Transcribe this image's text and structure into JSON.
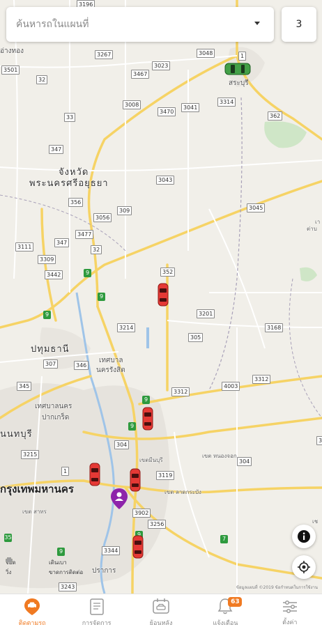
{
  "search": {
    "placeholder": "ค้นหารถในแผนที่"
  },
  "vehicle_count": "3",
  "map": {
    "places": {
      "saraburi": "สระบุรี",
      "changwat": "จังหวัด",
      "ayutthaya": "พระนครศรีอยุธยา",
      "pathum": "ปทุมธานี",
      "rangsit1": "เทศบาล",
      "rangsit2": "นครรังสิต",
      "pakkret1": "เทศบาลนคร",
      "pakkret2": "ปากเกร็ด",
      "nonthaburi": "นนทบุรี",
      "bangkok": "กรุงเทพมหานคร",
      "nongchok": "เขต หนองจอก",
      "minburi": "เขตมีนบุรี",
      "latkrabang": "เขต ลาดกระบัง",
      "sathon": "เขต สาทร",
      "samutprakan": "ปราการ",
      "angthong": "อ่างทอง",
      "right1": "เา",
      "right2": "ต่าบ",
      "right3": "เช"
    },
    "roads": [
      "3196",
      "3267",
      "3048",
      "3501",
      "3467",
      "3023",
      "1",
      "32",
      "3008",
      "3470",
      "3041",
      "3314",
      "362",
      "33",
      "347",
      "3043",
      "356",
      "309",
      "3056",
      "3045",
      "347",
      "3477",
      "3111",
      "32",
      "3309",
      "3442",
      "352",
      "3214",
      "3201",
      "305",
      "3168",
      "307",
      "346",
      "345",
      "3312",
      "4003",
      "3312",
      "3215",
      "304",
      "3119",
      "304",
      "1",
      "3902",
      "3256",
      "3344",
      "3243",
      "304",
      "9",
      "9",
      "9",
      "9",
      "7",
      "9",
      "35",
      "9",
      "9"
    ],
    "attribution": "ข้อมูลแผนที่ ©2019   ข้อกำหนดในการใช้งาน"
  },
  "legend": {
    "items": [
      {
        "label": "จอด",
        "color": "#e53935"
      },
      {
        "label": "เดินเบา",
        "color": "#f5a623"
      },
      {
        "label": "วิ่ง",
        "color": "#43a047"
      },
      {
        "label": "ขาดการติดต่อ",
        "color": "#9e9e9e"
      }
    ]
  },
  "nav": {
    "items": [
      {
        "label": "ติดตามรถ",
        "icon": "car-pin-icon",
        "active": true
      },
      {
        "label": "การจัดการ",
        "icon": "document-icon",
        "active": false
      },
      {
        "label": "ย้อนหลัง",
        "icon": "history-car-icon",
        "active": false
      },
      {
        "label": "แจ้งเตือน",
        "icon": "bell-icon",
        "active": false,
        "badge": "63"
      },
      {
        "label": "ตั้งค่า",
        "icon": "sliders-icon",
        "active": false
      }
    ]
  },
  "colors": {
    "accent": "#f07a22",
    "car_parked": "#e53935",
    "car_running": "#43a047",
    "pin": "#8e24aa"
  }
}
